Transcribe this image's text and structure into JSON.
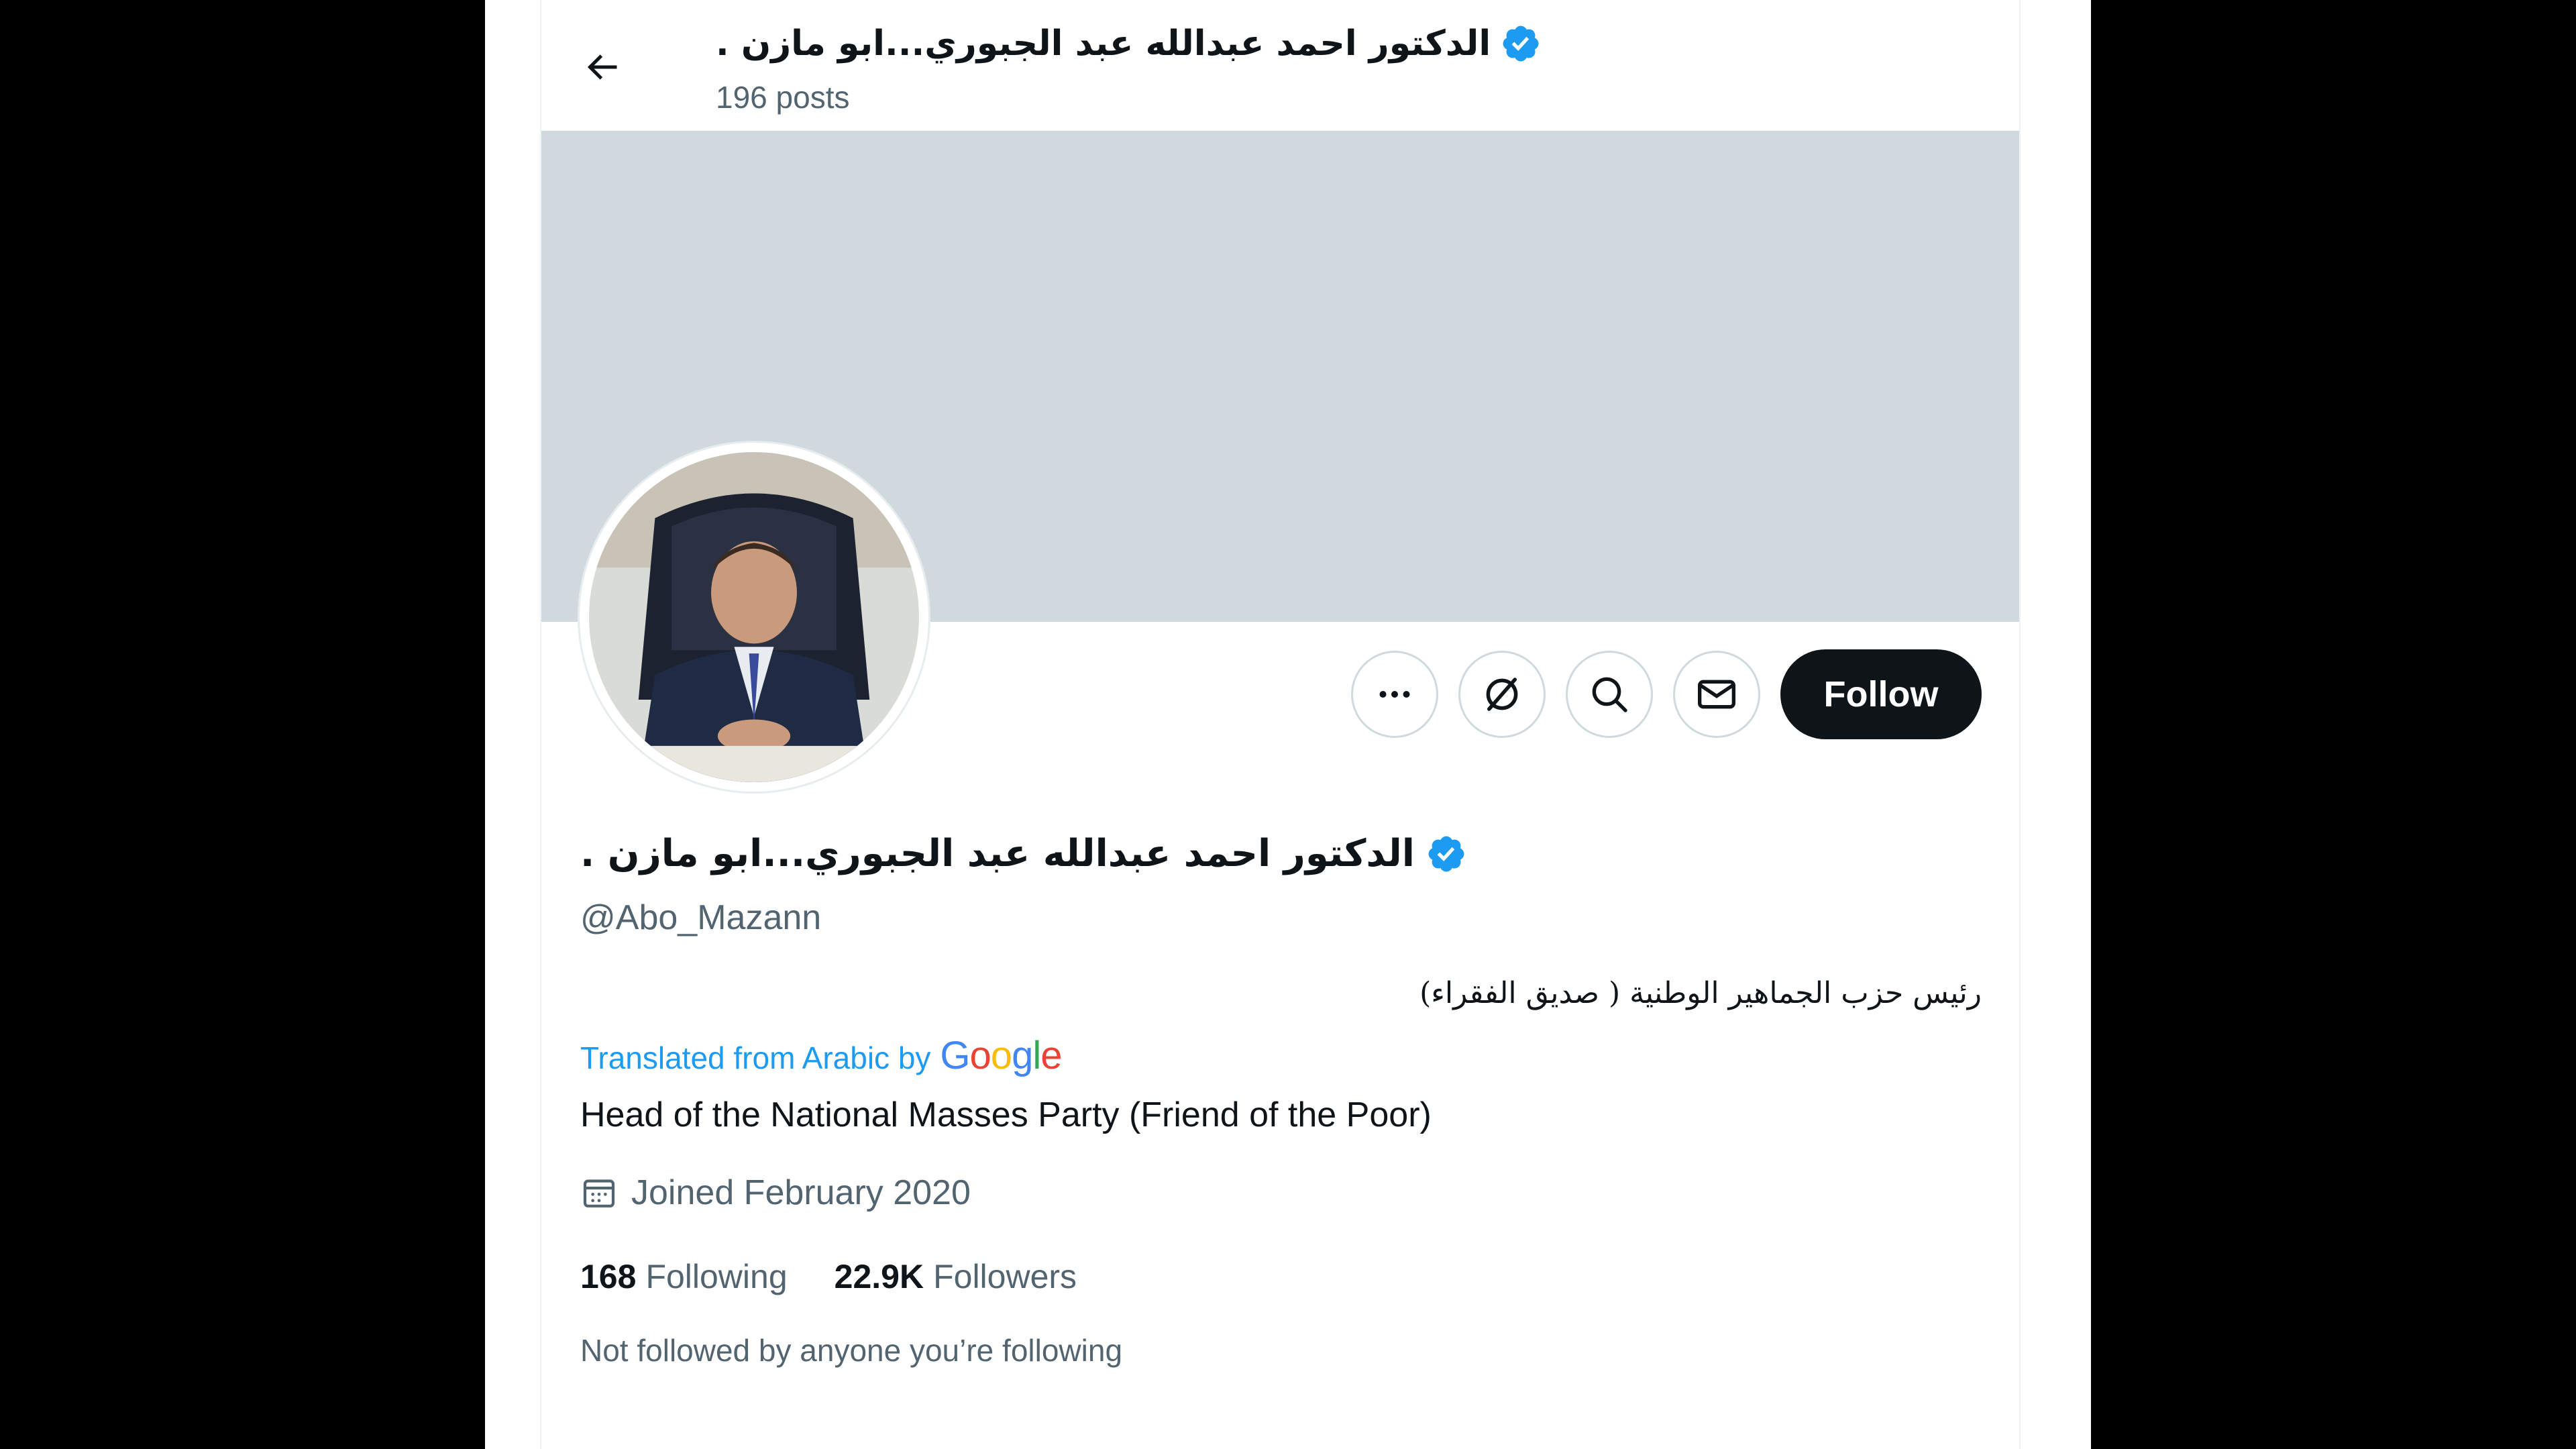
{
  "header": {
    "title": "الدكتور احمد عبدالله عبد الجبوري...ابو مازن .",
    "posts_count": "196 posts"
  },
  "profile": {
    "display_name": "الدكتور احمد عبدالله عبد الجبوري...ابو مازن .",
    "handle": "@Abo_Mazann",
    "bio_original": "رئيس حزب الجماهير الوطنية ( صديق الفقراء)",
    "translated_prefix": "Translated from Arabic by",
    "translated_brand": "Google",
    "bio_translated": "Head of the National Masses Party (Friend of the Poor)",
    "joined": "Joined February 2020",
    "following_count": "168",
    "following_label": "Following",
    "followers_count": "22.9K",
    "followers_label": "Followers",
    "not_followed_note": "Not followed by anyone you’re following"
  },
  "actions": {
    "more_icon": "more-horizontal-icon",
    "grok_icon": "grok-icon",
    "search_icon": "search-icon",
    "message_icon": "envelope-icon",
    "follow_label": "Follow"
  },
  "colors": {
    "accent": "#1d9bf0",
    "banner": "#cfd9de",
    "text_primary": "#0f1419",
    "text_secondary": "#536471",
    "follow_bg": "#0f1419"
  }
}
